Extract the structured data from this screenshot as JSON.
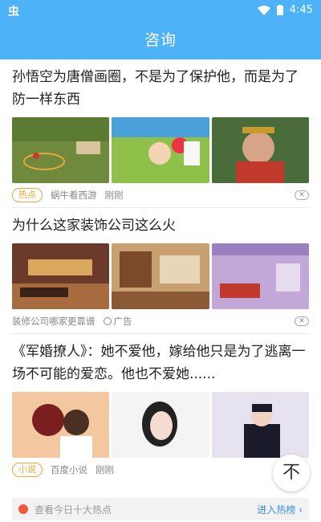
{
  "statusbar": {
    "app_icon": "虫",
    "time": "4:45"
  },
  "header": {
    "title": "咨询"
  },
  "articles": [
    {
      "title": "孙悟空为唐僧画圈，不是为了保护他，而是为了防一样东西",
      "tag": "热点",
      "source": "蜗牛看西游",
      "time": "刚刚"
    },
    {
      "title": "为什么这家装饰公司这么火",
      "source": "装修公司哪家更靠谱",
      "ad_label": "广告"
    },
    {
      "title": "《军婚撩人》：她不爱他，嫁给他只是为了逃离一场不可能的爱恋。他也不爱她......",
      "tag": "小说",
      "source": "百度小说",
      "time": "刚刚"
    }
  ],
  "fab": {
    "label": "不"
  },
  "bottombar": {
    "text": "查看今日十大热点",
    "link": "进入热榜 ›"
  }
}
